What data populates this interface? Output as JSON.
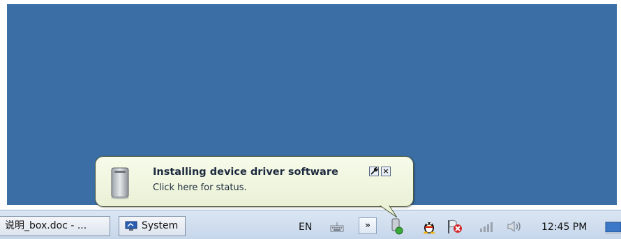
{
  "notification": {
    "title": "Installing device driver software",
    "text": "Click here for status.",
    "options_icon": "wrench-icon",
    "close_label": "×"
  },
  "taskbar": {
    "buttons": [
      {
        "label": "说明_box.doc - ...",
        "icon": ""
      },
      {
        "label": "System",
        "icon": "system-monitor-icon"
      }
    ],
    "language": "EN",
    "tray_chevron": "»",
    "clock": "12:45 PM"
  },
  "colors": {
    "desktop": "#3a6ea5",
    "balloon_bg": "#eef4dd",
    "taskbar_bg": "#d4e0ef"
  }
}
